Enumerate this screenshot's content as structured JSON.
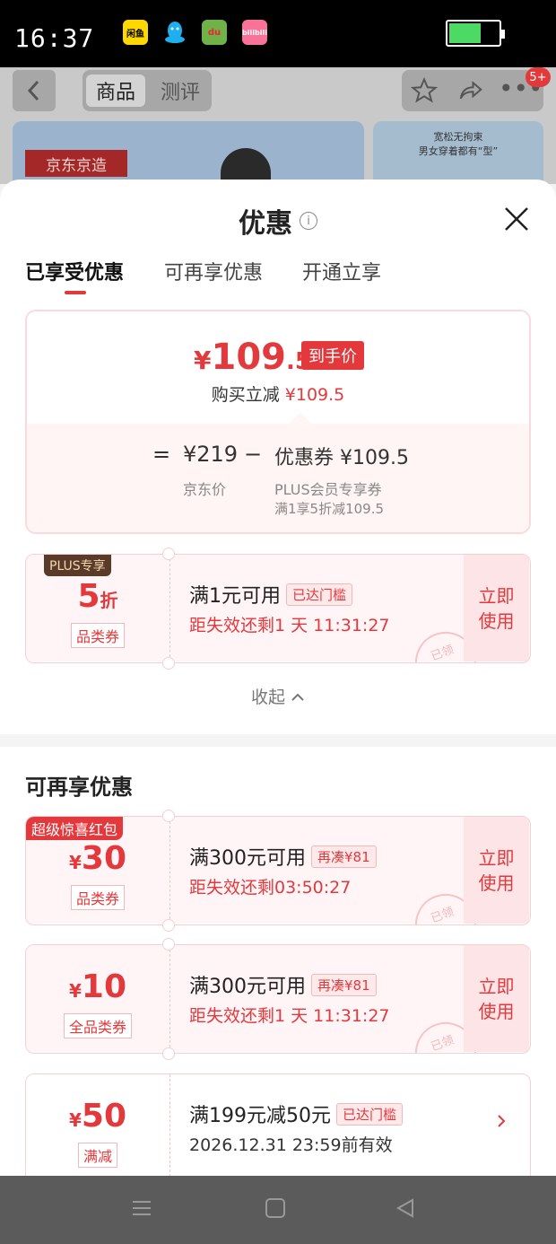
{
  "status_bar": {
    "time": "16:37",
    "apps": [
      {
        "name": "闲鱼",
        "color": "#ffd800"
      },
      {
        "name": "QQ",
        "color": "#1db0f0"
      },
      {
        "name": "du",
        "color": "#6fb248"
      },
      {
        "name": "bilibili",
        "color": "#fb7299"
      }
    ],
    "battery_level": 0.65
  },
  "background_page": {
    "tab_active": "商品",
    "tab_inactive": "测评",
    "message_badge": "5+",
    "banner_brand": "京东京造",
    "banner2_text_line1": "宽松无拘束",
    "banner2_text_line2": "男女穿着都有“型”"
  },
  "sheet": {
    "title": "优惠",
    "tabs": [
      "已享受优惠",
      "可再享优惠",
      "开通立享"
    ],
    "active_tab": 0
  },
  "summary": {
    "currency": "¥",
    "final_price_int": "109",
    "final_price_dec": ".5",
    "final_price_tag": "到手价",
    "reduce_label": "购买立减",
    "reduce_value": "¥109.5",
    "equals": "=",
    "jd_price": "¥219",
    "minus": "−",
    "coupon_line": "优惠券 ¥109.5",
    "jd_price_label": "京东价",
    "coupon_label": "PLUS会员专享券",
    "coupon_rule": "满1享5折减109.5"
  },
  "used_coupons": [
    {
      "badge": "PLUS专享",
      "amount": "5",
      "unit": "折",
      "type": "品类券",
      "condition": "满1元可用",
      "tag": "已达门槛",
      "expiry": "距失效还剩1 天 11:31:27",
      "action": "立即\n使用",
      "stamp": "已领"
    }
  ],
  "collapse_label": "收起",
  "more_section_title": "可再享优惠",
  "more_coupons": [
    {
      "badge": "超级惊喜红包",
      "currency": "¥",
      "amount": "30",
      "type": "品类券",
      "condition": "满300元可用",
      "tag": "再凑¥81",
      "expiry": "距失效还剩03:50:27",
      "action": "立即\n使用",
      "stamp": "已领"
    },
    {
      "badge": "",
      "currency": "¥",
      "amount": "10",
      "type": "全品类券",
      "condition": "满300元可用",
      "tag": "再凑¥81",
      "expiry": "距失效还剩1 天 11:31:27",
      "action": "立即\n使用",
      "stamp": "已领"
    },
    {
      "badge": "",
      "currency": "¥",
      "amount": "50",
      "type": "满减",
      "condition": "满199元减50元",
      "tag": "已达门槛",
      "expiry": "2026.12.31 23:59前有效",
      "action": "",
      "stamp": ""
    }
  ],
  "colors": {
    "accent": "#e4393c",
    "coupon_bg": "#fff5f6",
    "plus_badge": "#5a3b2a"
  }
}
